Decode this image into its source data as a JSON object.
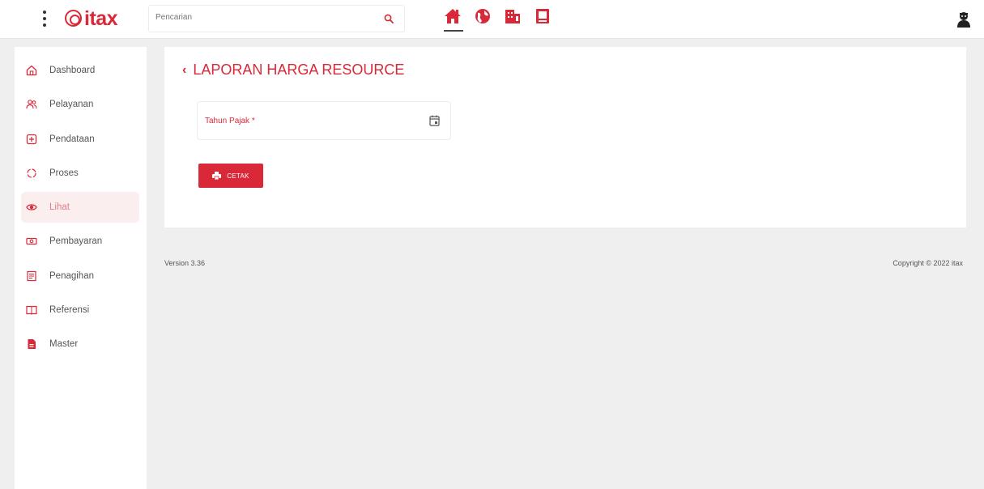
{
  "header": {
    "logo_text": "itax",
    "search_placeholder": "Pencarian",
    "nav_icons": [
      "home-icon",
      "globe-icon",
      "building-icon",
      "document-icon"
    ],
    "user_icon": "user-icon"
  },
  "sidebar": {
    "items": [
      {
        "label": "Dashboard",
        "icon": "home-outline-icon"
      },
      {
        "label": "Pelayanan",
        "icon": "users-icon"
      },
      {
        "label": "Pendataan",
        "icon": "plus-box-icon"
      },
      {
        "label": "Proses",
        "icon": "spinner-icon"
      },
      {
        "label": "Lihat",
        "icon": "eye-icon"
      },
      {
        "label": "Pembayaran",
        "icon": "money-icon"
      },
      {
        "label": "Penagihan",
        "icon": "bill-icon"
      },
      {
        "label": "Referensi",
        "icon": "book-icon"
      },
      {
        "label": "Master",
        "icon": "file-icon"
      }
    ],
    "active_index": 4
  },
  "main": {
    "title": "LAPORAN HARGA RESOURCE",
    "field_label": "Tahun Pajak *",
    "print_button": "CETAK"
  },
  "footer": {
    "version": "Version 3.36",
    "copyright": "Copyright © 2022 itax"
  },
  "colors": {
    "accent": "#d92938",
    "active_bg": "#fbeeee",
    "background": "#efefef"
  }
}
